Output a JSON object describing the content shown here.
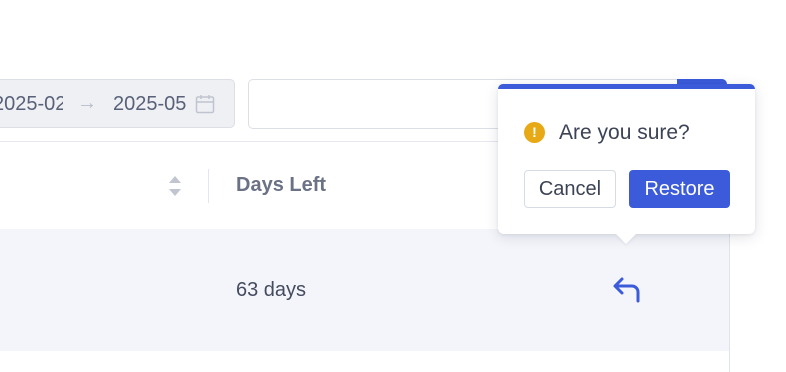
{
  "filters": {
    "date_range": {
      "start": "2025-02",
      "end": "2025-05",
      "separator": "→"
    },
    "search": {
      "value": ""
    }
  },
  "table": {
    "columns": [
      {
        "label": ""
      },
      {
        "label": "Days Left"
      }
    ],
    "rows": [
      {
        "days_left": "63 days"
      }
    ]
  },
  "popconfirm": {
    "message": "Are you sure?",
    "warning_symbol": "!",
    "cancel_label": "Cancel",
    "confirm_label": "Restore"
  },
  "icons": {
    "calendar": "calendar-icon",
    "sort": "sort-icon",
    "restore": "undo-arrow-icon",
    "warning": "exclamation-circle-icon"
  },
  "colors": {
    "primary": "#3b5bdb",
    "warning": "#e8a917",
    "row_bg": "#f4f5fa"
  }
}
